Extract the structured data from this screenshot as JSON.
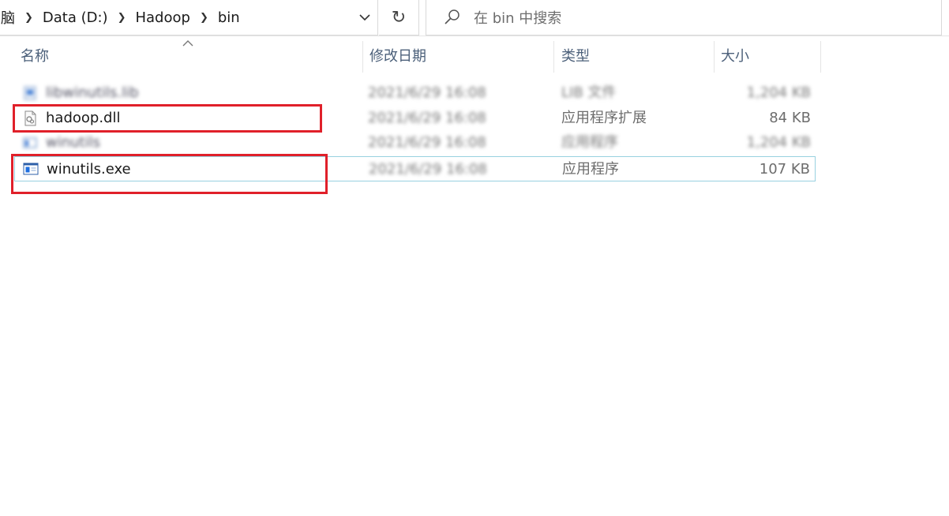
{
  "breadcrumb": {
    "items": [
      "脑",
      "Data (D:)",
      "Hadoop",
      "bin"
    ]
  },
  "search": {
    "placeholder": "在 bin 中搜索"
  },
  "columns": {
    "name": "名称",
    "date": "修改日期",
    "type": "类型",
    "size": "大小"
  },
  "files": [
    {
      "name": "libwinutils.lib",
      "date": "2021/6/29 16:08",
      "type": "LIB 文件",
      "size": "1,204 KB",
      "blurred": true,
      "icon": "generic-file-icon"
    },
    {
      "name": "hadoop.dll",
      "date": "2021/6/29 16:08",
      "type": "应用程序扩展",
      "size": "84 KB",
      "blurred_date": true,
      "icon": "dll-file-icon"
    },
    {
      "name": "winutils",
      "date": "2021/6/29 16:08",
      "type": "应用程序",
      "size": "1,204 KB",
      "blurred": true,
      "icon": "exe-file-icon"
    },
    {
      "name": "winutils.exe",
      "date": "2021/6/29 16:08",
      "type": "应用程序",
      "size": "107 KB",
      "blurred_date": true,
      "icon": "exe-file-icon"
    }
  ],
  "colors": {
    "highlight": "#e0202a",
    "header_text": "#4c607a",
    "selection_border": "#99d1e0"
  }
}
